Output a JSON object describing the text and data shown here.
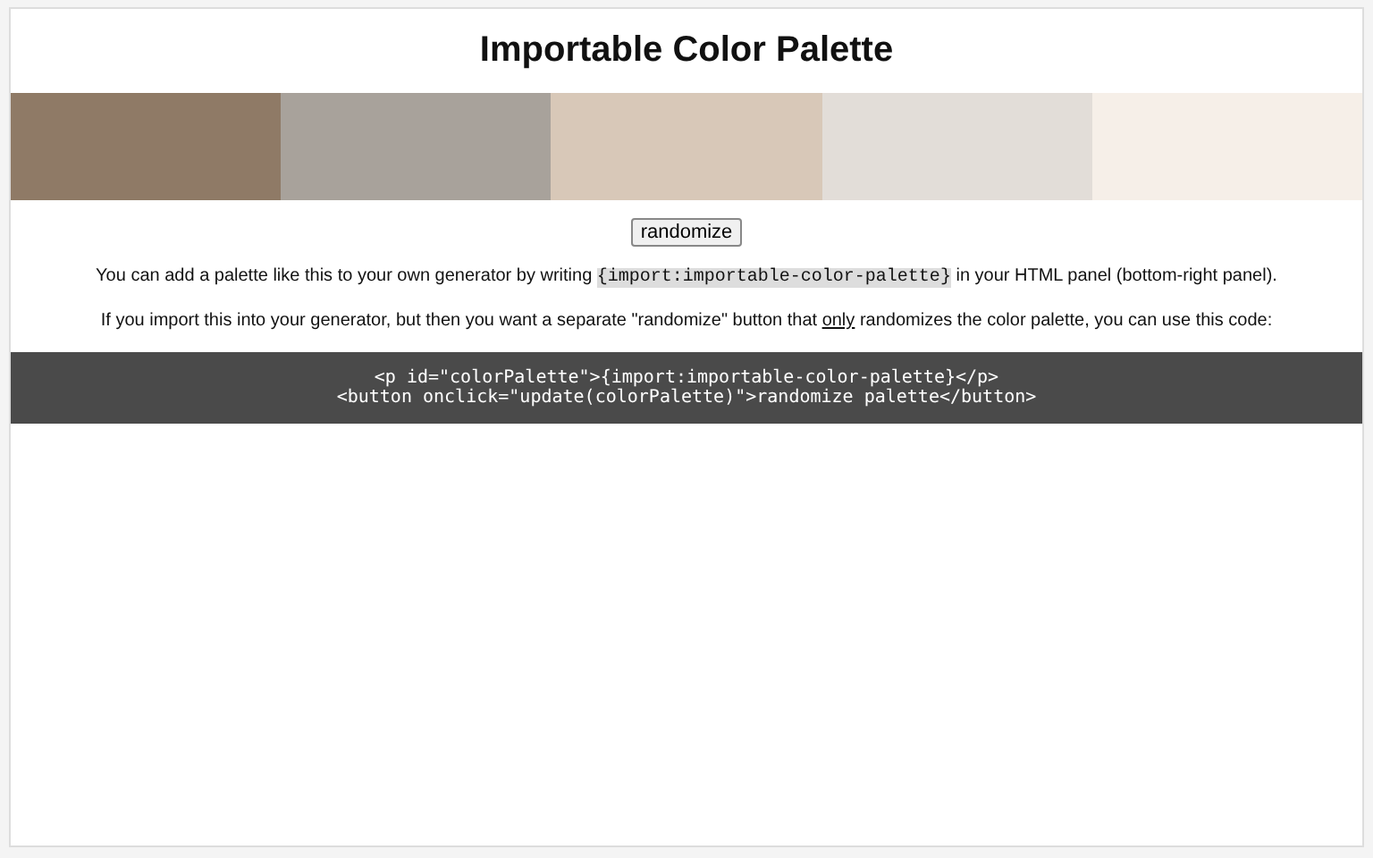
{
  "title": "Importable Color Palette",
  "swatches": [
    {
      "color": "#8f7a66"
    },
    {
      "color": "#a8a29b"
    },
    {
      "color": "#d8c8b8"
    },
    {
      "color": "#e2ddd8"
    },
    {
      "color": "#f6efe8"
    }
  ],
  "button": "randomize",
  "paragraphs": [
    [
      {
        "kind": "text",
        "text": "You can add a palette like this to your own generator by writing "
      },
      {
        "kind": "code",
        "text": "{import:importable-color-palette}"
      },
      {
        "kind": "text",
        "text": " in your HTML panel (bottom-right panel)."
      }
    ],
    [
      {
        "kind": "text",
        "text": "If you import this into your generator, but then you want a separate \"randomize\" button that "
      },
      {
        "kind": "underline",
        "text": "only"
      },
      {
        "kind": "text",
        "text": " randomizes the color palette, you can use this code:"
      }
    ]
  ],
  "code_lines": [
    "<p id=\"colorPalette\">{import:importable-color-palette}</p>",
    "<button onclick=\"update(colorPalette)\">randomize palette</button>"
  ]
}
